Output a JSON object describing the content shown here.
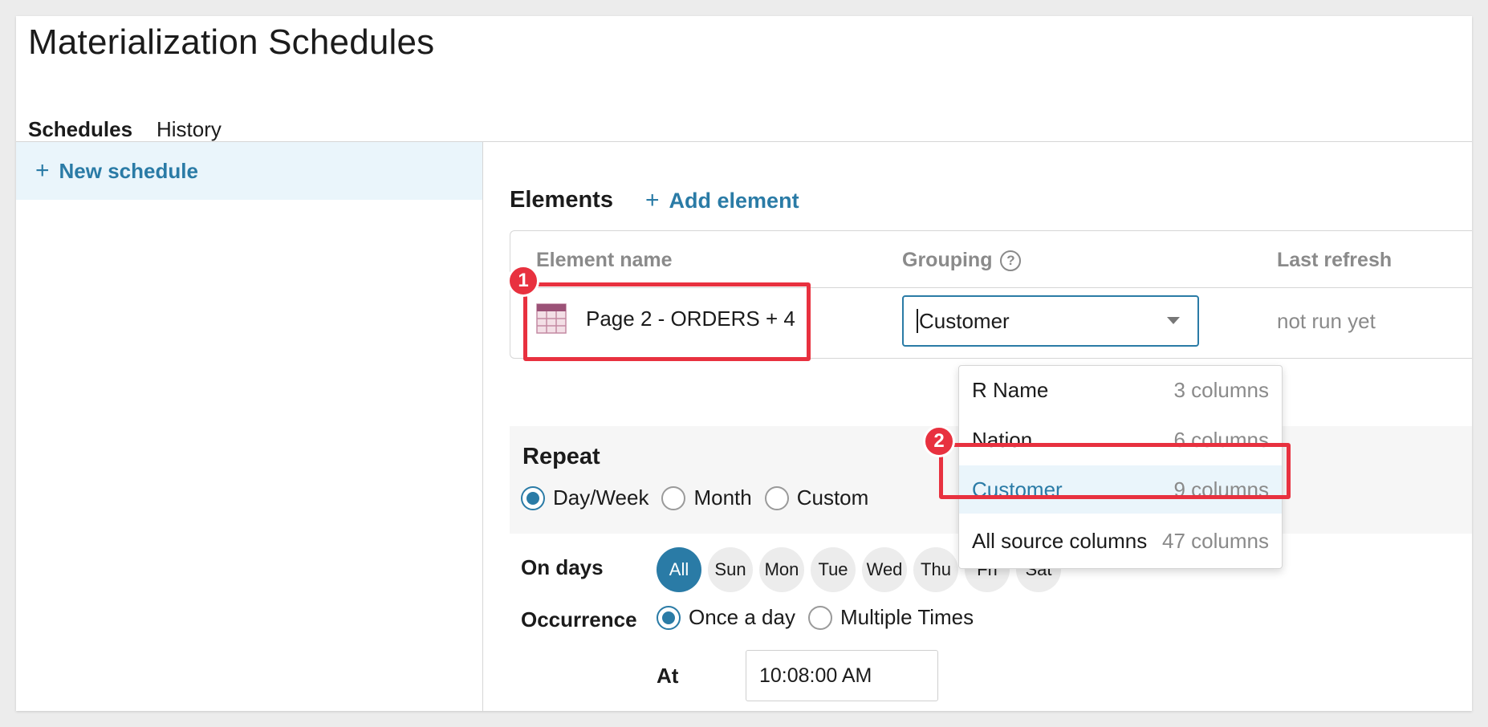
{
  "page": {
    "title": "Materialization Schedules"
  },
  "tabs": [
    {
      "label": "Schedules",
      "active": true
    },
    {
      "label": "History",
      "active": false
    }
  ],
  "sidebar": {
    "new_schedule_label": "New schedule"
  },
  "elements": {
    "heading": "Elements",
    "add_label": "Add element",
    "columns": {
      "name": "Element name",
      "grouping": "Grouping",
      "last_refresh": "Last refresh"
    },
    "row": {
      "name": "Page 2 - ORDERS + 4",
      "grouping": "Customer",
      "last_refresh": "not run yet"
    }
  },
  "dropdown": {
    "options": [
      {
        "label": "R Name",
        "cols": "3 columns"
      },
      {
        "label": "Nation",
        "cols": "6 columns"
      },
      {
        "label": "Customer",
        "cols": "9 columns",
        "selected": true
      },
      {
        "label": "All source columns",
        "cols": "47 columns"
      }
    ]
  },
  "repeat": {
    "title": "Repeat",
    "options": [
      "Day/Week",
      "Month",
      "Custom"
    ],
    "selected": "Day/Week"
  },
  "on_days": {
    "label": "On days",
    "days": [
      "All",
      "Sun",
      "Mon",
      "Tue",
      "Wed",
      "Thu",
      "Fri",
      "Sat"
    ],
    "selected": "All"
  },
  "occurrence": {
    "label": "Occurrence",
    "options": [
      "Once a day",
      "Multiple Times"
    ],
    "selected": "Once a day"
  },
  "at": {
    "label": "At",
    "time": "10:08:00 AM"
  },
  "annotations": {
    "badge1": "1",
    "badge2": "2"
  },
  "colors": {
    "accent": "#2a7ba6",
    "highlight": "#e8313f",
    "selected_bg": "#eaf5fb"
  }
}
